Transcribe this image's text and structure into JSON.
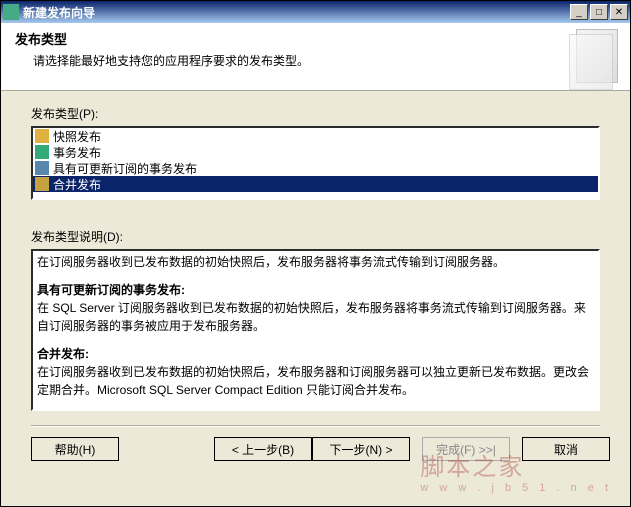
{
  "title": "新建发布向导",
  "header": {
    "title": "发布类型",
    "subtitle": "请选择能最好地支持您的应用程序要求的发布类型。"
  },
  "labels": {
    "type_list": "发布类型(P):",
    "type_desc": "发布类型说明(D):"
  },
  "list": {
    "items": [
      {
        "label": "快照发布"
      },
      {
        "label": "事务发布"
      },
      {
        "label": "具有可更新订阅的事务发布"
      },
      {
        "label": "合并发布"
      }
    ],
    "selected_index": 3
  },
  "desc": {
    "p1": "在订阅服务器收到已发布数据的初始快照后，发布服务器将事务流式传输到订阅服务器。",
    "t2": "具有可更新订阅的事务发布:",
    "p2": "在 SQL Server 订阅服务器收到已发布数据的初始快照后，发布服务器将事务流式传输到订阅服务器。来自订阅服务器的事务被应用于发布服务器。",
    "t3": "合并发布:",
    "p3": "在订阅服务器收到已发布数据的初始快照后，发布服务器和订阅服务器可以独立更新已发布数据。更改会定期合并。Microsoft SQL Server Compact Edition 只能订阅合并发布。"
  },
  "buttons": {
    "help": "帮助(H)",
    "back": "< 上一步(B)",
    "next": "下一步(N) >",
    "finish": "完成(F) >>|",
    "cancel": "取消"
  },
  "watermark": {
    "text": "脚本之家",
    "url": "w w w . j b 5 1 . n e t"
  }
}
